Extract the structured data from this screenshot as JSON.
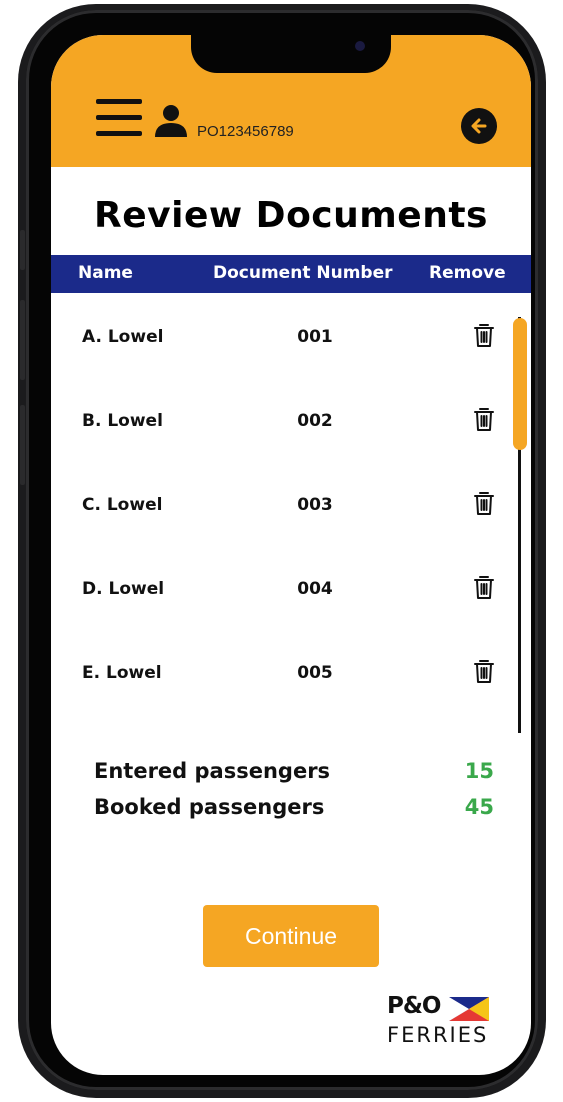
{
  "header": {
    "user_id": "PO123456789"
  },
  "page": {
    "title": "Review Documents"
  },
  "table": {
    "columns": [
      "Name",
      "Document Number",
      "Remove"
    ],
    "rows": [
      {
        "name": "A. Lowel",
        "doc": "001"
      },
      {
        "name": "B. Lowel",
        "doc": "002"
      },
      {
        "name": "C. Lowel",
        "doc": "003"
      },
      {
        "name": "D. Lowel",
        "doc": "004"
      },
      {
        "name": "E. Lowel",
        "doc": "005"
      }
    ]
  },
  "summary": {
    "entered_label": "Entered passengers",
    "entered_value": "15",
    "booked_label": "Booked passengers",
    "booked_value": "45"
  },
  "actions": {
    "continue_label": "Continue"
  },
  "logo": {
    "top": "P&O",
    "bottom": "FERRIES"
  },
  "icons": {
    "menu": "hamburger-menu-icon",
    "user": "user-icon",
    "back": "arrow-left-icon",
    "remove": "trash-icon"
  },
  "colors": {
    "accent": "#f5a623",
    "table_header": "#1b2a8a",
    "count_green": "#3aa84b"
  }
}
